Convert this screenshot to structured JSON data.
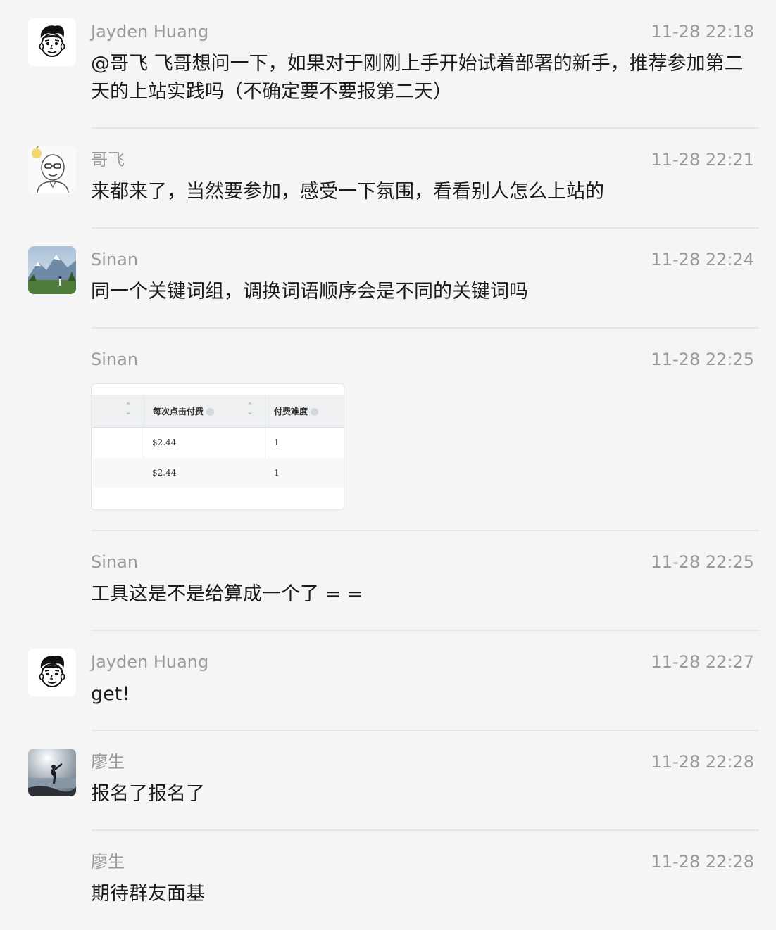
{
  "messages": [
    {
      "sender": "Jayden Huang",
      "time": "11-28 22:18",
      "text": "@哥飞 飞哥想问一下，如果对于刚刚上手开始试着部署的新手，推荐参加第二天的上站实践吗（不确定要不要报第二天）",
      "avatar": "cartoon-face-avatar"
    },
    {
      "sender": "哥飞",
      "time": "11-28 22:21",
      "text": "来都来了，当然要参加，感受一下氛围，看看别人怎么上站的",
      "avatar": "bald-glasses-avatar"
    },
    {
      "sender": "Sinan",
      "time": "11-28 22:24",
      "text": "同一个关键词组，调换词语顺序会是不同的关键词吗",
      "avatar": "mountain-photo-avatar"
    },
    {
      "sender": "Sinan",
      "time": "11-28 22:25",
      "image_table": {
        "headers": [
          "每次点击付费",
          "付费难度"
        ],
        "rows": [
          [
            "$2.44",
            "1"
          ],
          [
            "$2.44",
            "1"
          ]
        ]
      }
    },
    {
      "sender": "Sinan",
      "time": "11-28 22:25",
      "text": "工具这是不是给算成一个了 = ="
    },
    {
      "sender": "Jayden Huang",
      "time": "11-28 22:27",
      "text": "get!",
      "avatar": "cartoon-face-avatar"
    },
    {
      "sender": "廖生",
      "time": "11-28 22:28",
      "text": "报名了报名了",
      "avatar": "lake-silhouette-avatar"
    },
    {
      "sender": "廖生",
      "time": "11-28 22:28",
      "text": "期待群友面基"
    }
  ]
}
